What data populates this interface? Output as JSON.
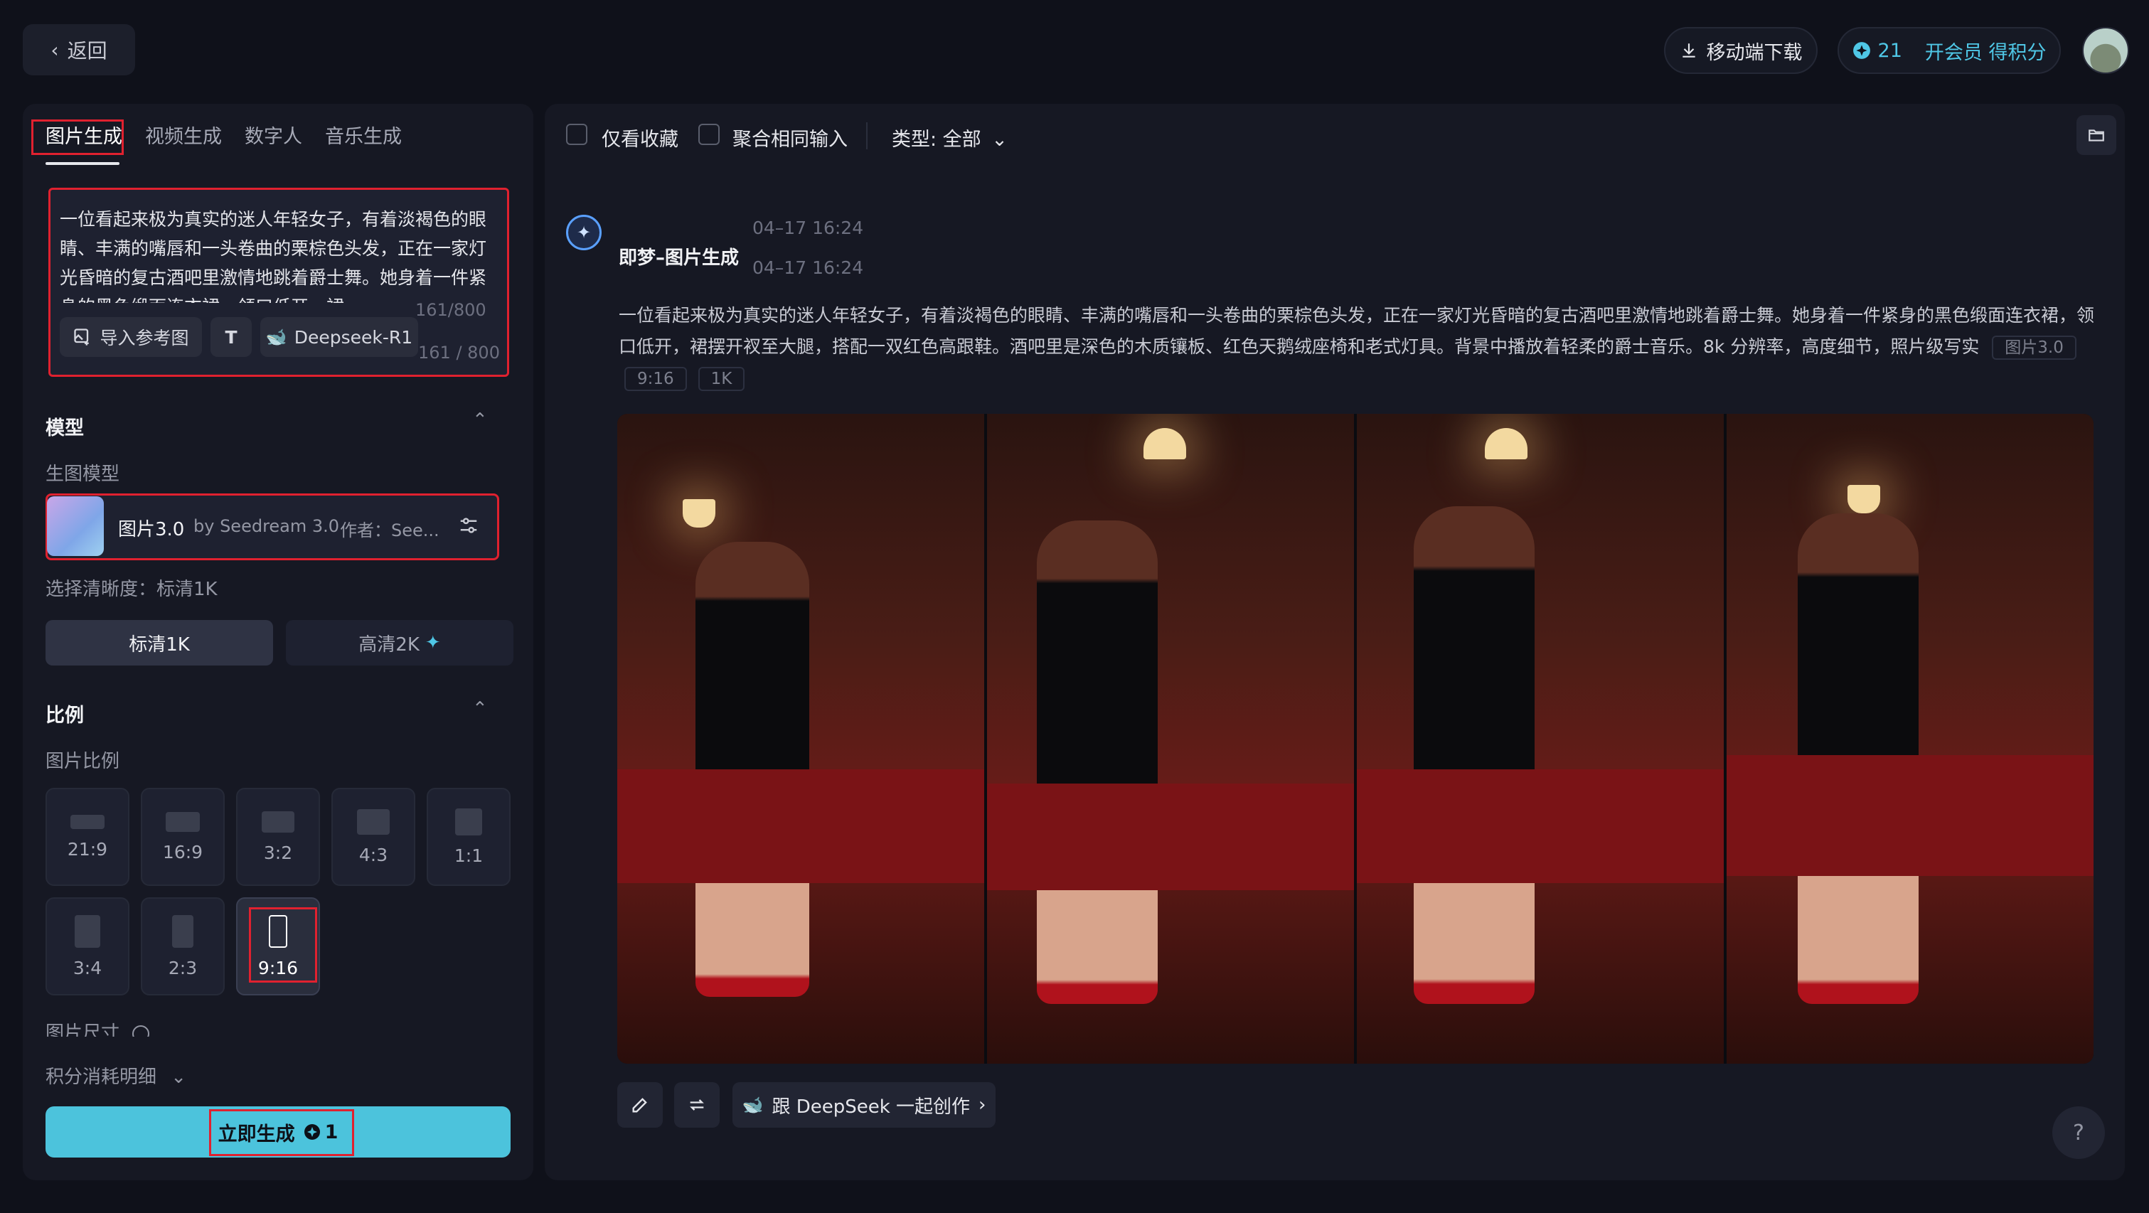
{
  "topbar": {
    "back_label": "返回",
    "download_label": "移动端下载",
    "points": "21",
    "member_label": "开会员 得积分"
  },
  "left": {
    "tabs": [
      "图片生成",
      "视频生成",
      "数字人",
      "音乐生成"
    ],
    "prompt": "一位看起来极为真实的迷人年轻女子，有着淡褐色的眼睛、丰满的嘴唇和一头卷曲的栗棕色头发，正在一家灯光昏暗的复古酒吧里激情地跳着爵士舞。她身着一件紧身的黑色缎面连衣裙，领口低开，裙",
    "char_count_ghost": "161/800",
    "char_count": "161 / 800",
    "chip_ref": "导入参考图",
    "chip_text": "T",
    "chip_deepseek": "Deepseek-R1",
    "model_section": "模型",
    "model_sub": "生图模型",
    "model_name": "图片3.0",
    "model_by": "by Seedream 3.0",
    "model_author": "作者：See...",
    "resolution_label": "选择清晰度：标清1K",
    "res_1k": "标清1K",
    "res_2k": "高清2K",
    "ratio_section": "比例",
    "ratio_sub": "图片比例",
    "ratios": [
      "21:9",
      "16:9",
      "3:2",
      "4:3",
      "1:1",
      "3:4",
      "2:3",
      "9:16"
    ],
    "size_label": "图片尺寸",
    "cost_label": "积分消耗明细",
    "generate_label": "立即生成",
    "generate_cost": "1"
  },
  "right": {
    "filter_fav": "仅看收藏",
    "filter_merge": "聚合相同输入",
    "type_filter": "类型: 全部",
    "source_name": "即梦–图片生成",
    "time1": "04–17  16:24",
    "time2": "04–17  16:24",
    "prompt_full": "一位看起来极为真实的迷人年轻女子，有着淡褐色的眼睛、丰满的嘴唇和一头卷曲的栗棕色头发，正在一家灯光昏暗的复古酒吧里激情地跳着爵士舞。她身着一件紧身的黑色缎面连衣裙，领口低开，裙摆开衩至大腿，搭配一双红色高跟鞋。酒吧里是深色的木质镶板、红色天鹅绒座椅和老式灯具。背景中播放着轻柔的爵士音乐。8k 分辨率，高度细节，照片级写实",
    "tags": [
      "图片3.0",
      "9:16",
      "1K"
    ],
    "deepseek_action": "跟 DeepSeek 一起创作",
    "help": "?"
  },
  "colors": {
    "accent": "#4cc3dc",
    "highlight_box": "#e0212f",
    "panel": "#161823",
    "background": "#0f111a"
  }
}
